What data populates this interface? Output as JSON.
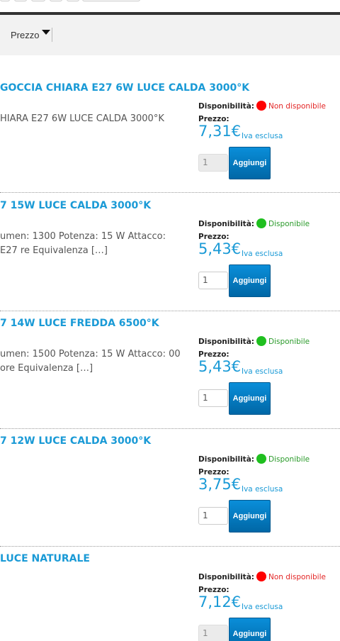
{
  "sort": {
    "label": "Prezzo"
  },
  "labels": {
    "availability": "Disponibilità:",
    "price": "Prezzo:",
    "vat": "Iva esclusa",
    "add": "Aggiungi"
  },
  "colors": {
    "accent": "#1a9ad6",
    "unavailable": "#ff0000",
    "available": "#1fbf1f",
    "button": "#0a7fc4"
  },
  "products": [
    {
      "title": "GOCCIA CHIARA E27 6W LUCE CALDA 3000°K",
      "desc": "HIARA E27 6W LUCE CALDA 3000°K",
      "status": "Non disponibile",
      "price": "7,31€",
      "qty": "1"
    },
    {
      "title": "7 15W LUCE CALDA 3000°K",
      "desc": "umen: 1300 Potenza: 15 W Attacco: E27 re Equivalenza […]",
      "status": "Disponibile",
      "price": "5,43€",
      "qty": "1"
    },
    {
      "title": "7 14W LUCE FREDDA 6500°K",
      "desc": "umen: 1500 Potenza: 15 W Attacco: 00 ore Equivalenza […]",
      "status": "Disponibile",
      "price": "5,43€",
      "qty": "1"
    },
    {
      "title": "7 12W LUCE CALDA 3000°K",
      "desc": "",
      "status": "Disponibile",
      "price": "3,75€",
      "qty": "1"
    },
    {
      "title": "LUCE NATURALE",
      "desc": "",
      "status": "Non disponibile",
      "price": "7,12€",
      "qty": "1"
    }
  ]
}
